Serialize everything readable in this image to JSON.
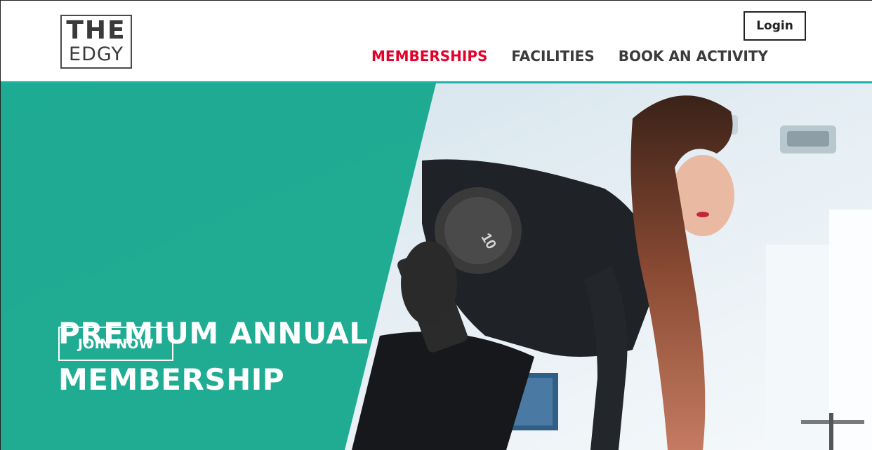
{
  "brand": {
    "logo_line1": "THE",
    "logo_line2": "EDGY"
  },
  "header": {
    "login_label": "Login",
    "nav": [
      {
        "label": "MEMBERSHIPS",
        "active": true
      },
      {
        "label": "FACILITIES",
        "active": false
      },
      {
        "label": "BOOK AN ACTIVITY",
        "active": false
      }
    ]
  },
  "hero": {
    "title_line1": "PREMIUM ANNUAL",
    "title_line2": "MEMBERSHIP",
    "cta_label": "JOIN NOW",
    "dumbbell_weight": "10"
  },
  "colors": {
    "accent_teal": "#17a98f",
    "nav_active": "#e4002b",
    "nav_text": "#3b3b3b",
    "divider": "#1ab3a6"
  }
}
